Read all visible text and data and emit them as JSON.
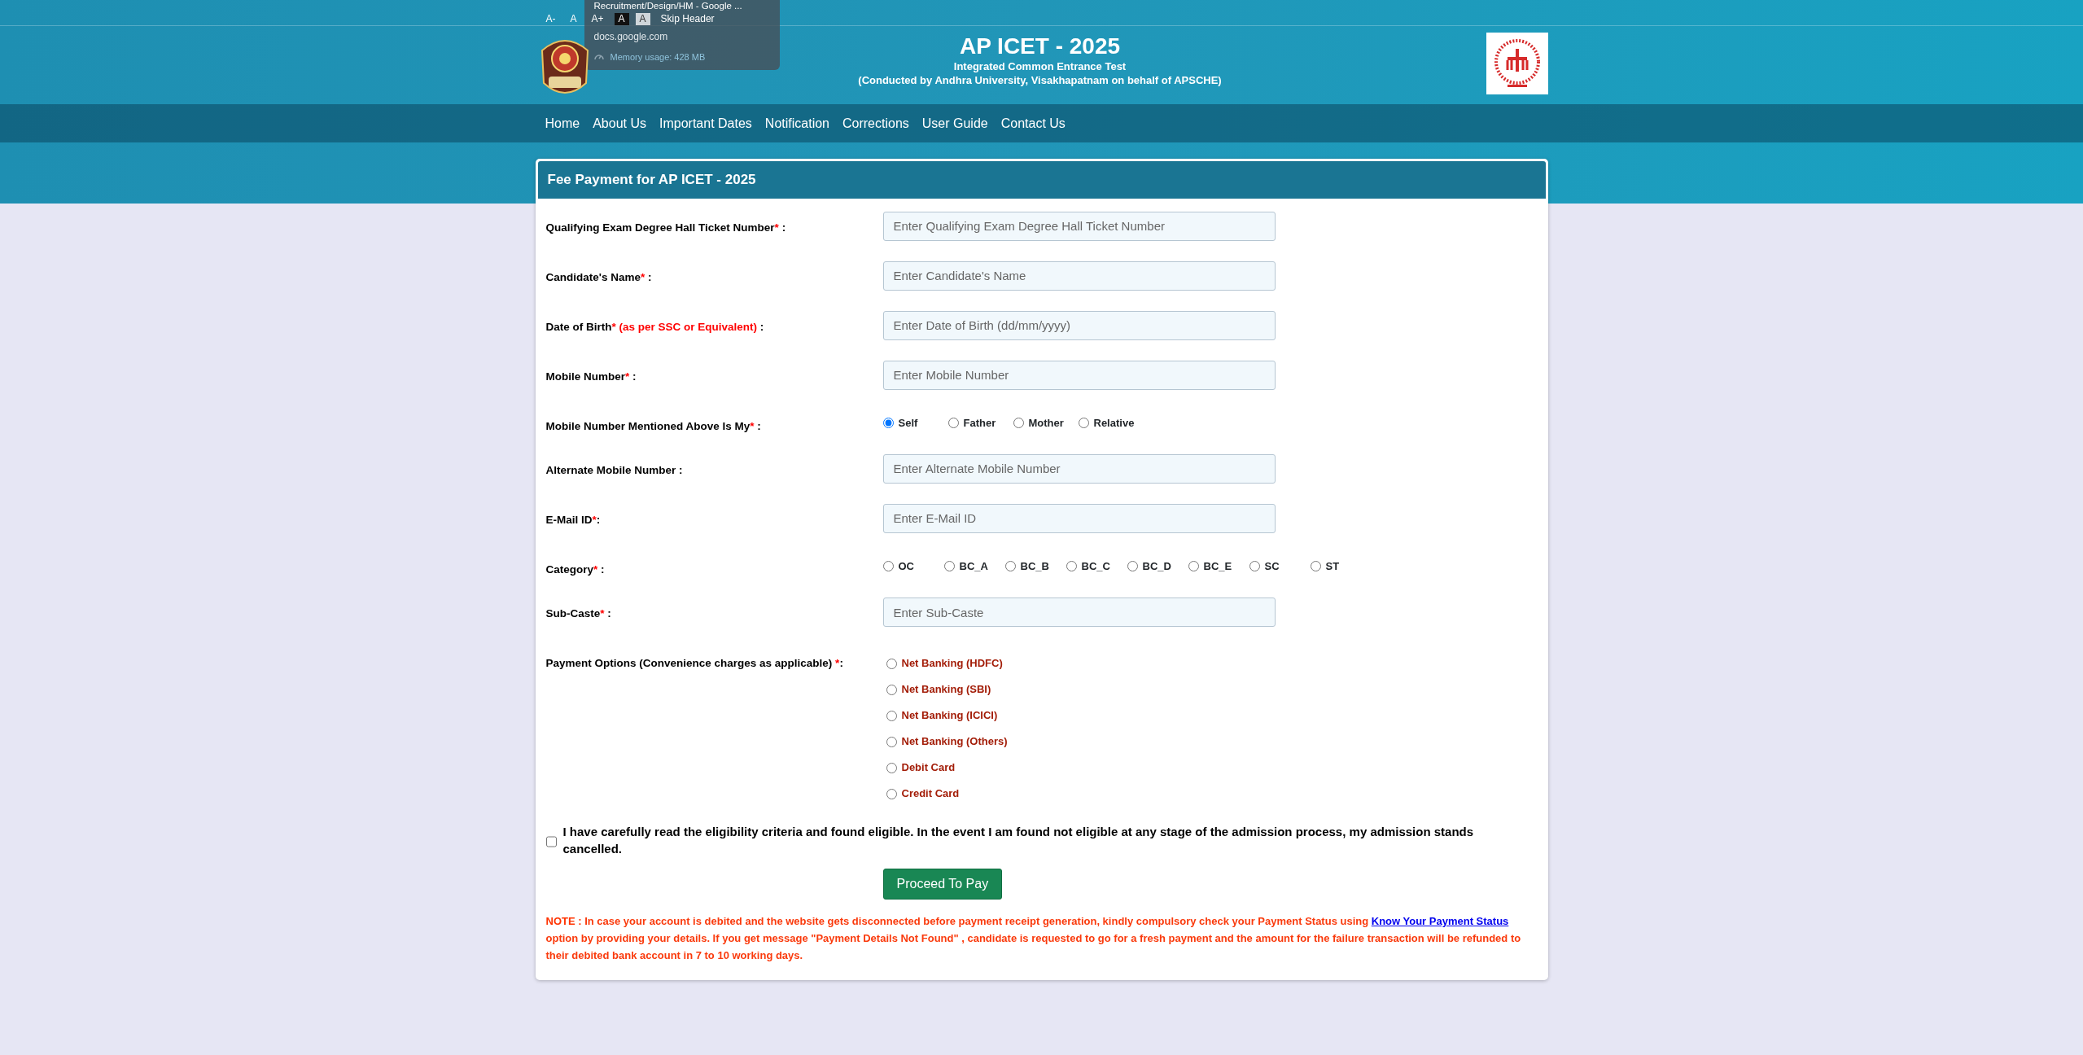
{
  "top_bar": {
    "items": [
      {
        "label": "A-",
        "kind": "plain"
      },
      {
        "label": "A",
        "kind": "plain"
      },
      {
        "label": "A+",
        "kind": "plain"
      },
      {
        "label": "A",
        "kind": "dark"
      },
      {
        "label": "A",
        "kind": "light"
      },
      {
        "label": "Skip Header",
        "kind": "plain"
      }
    ]
  },
  "hover_card": {
    "title": "Recruitment/Design/HM - Google ...",
    "url": "docs.google.com",
    "memory": "Memory usage: 428 MB"
  },
  "header": {
    "title": "AP ICET - 2025",
    "subtitle": "Integrated Common Entrance Test",
    "conducted_by": "(Conducted by Andhra University, Visakhapatnam on behalf of APSCHE)"
  },
  "nav": {
    "items": [
      "Home",
      "About Us",
      "Important Dates",
      "Notification",
      "Corrections",
      "User Guide",
      "Contact Us"
    ]
  },
  "form": {
    "title": "Fee Payment for AP ICET - 2025",
    "fields": [
      {
        "kind": "text",
        "label": "Qualifying Exam Degree Hall Ticket Number",
        "required_mark": "*",
        "suffix": " :",
        "placeholder": "Enter Qualifying Exam Degree Hall Ticket Number"
      },
      {
        "kind": "text",
        "label": "Candidate's Name",
        "required_mark": "*",
        "suffix": " :",
        "placeholder": "Enter Candidate's Name"
      },
      {
        "kind": "text",
        "label": "Date of Birth",
        "required_mark": "*",
        "note": " (as per SSC or Equivalent)",
        "suffix": " :",
        "placeholder": "Enter Date of Birth (dd/mm/yyyy)"
      },
      {
        "kind": "text",
        "label": "Mobile Number",
        "required_mark": "*",
        "suffix": " :",
        "placeholder": "Enter Mobile Number"
      },
      {
        "kind": "radio",
        "label": "Mobile Number Mentioned Above Is My",
        "required_mark": "*",
        "suffix": " :",
        "options": [
          {
            "label": "Self",
            "selected": true
          },
          {
            "label": "Father",
            "selected": false
          },
          {
            "label": "Mother",
            "selected": false
          },
          {
            "label": "Relative",
            "selected": false
          }
        ]
      },
      {
        "kind": "text",
        "label": "Alternate Mobile Number",
        "suffix": " :",
        "placeholder": "Enter Alternate Mobile Number"
      },
      {
        "kind": "text",
        "label": "E-Mail ID",
        "required_mark": "*",
        "suffix": ":",
        "placeholder": "Enter E-Mail ID"
      },
      {
        "kind": "radio",
        "label": "Category",
        "required_mark": "*",
        "suffix": " :",
        "options": [
          {
            "label": "OC",
            "selected": false
          },
          {
            "label": "BC_A",
            "selected": false
          },
          {
            "label": "BC_B",
            "selected": false
          },
          {
            "label": "BC_C",
            "selected": false
          },
          {
            "label": "BC_D",
            "selected": false
          },
          {
            "label": "BC_E",
            "selected": false
          },
          {
            "label": "SC",
            "selected": false
          },
          {
            "label": "ST",
            "selected": false
          }
        ]
      },
      {
        "kind": "text",
        "label": "Sub-Caste",
        "required_mark": "*",
        "suffix": " :",
        "placeholder": "Enter Sub-Caste"
      },
      {
        "kind": "radio-list",
        "label": "Payment Options (Convenience charges as applicable)",
        "required_mark": " *",
        "suffix": ":",
        "options": [
          {
            "label": "Net Banking (HDFC)",
            "selected": false
          },
          {
            "label": "Net Banking (SBI)",
            "selected": false
          },
          {
            "label": "Net Banking (ICICI)",
            "selected": false
          },
          {
            "label": "Net Banking (Others)",
            "selected": false
          },
          {
            "label": "Debit Card",
            "selected": false
          },
          {
            "label": "Credit Card",
            "selected": false
          }
        ]
      }
    ],
    "agreement": {
      "text": "I have carefully read the eligibility criteria and found eligible. In the event I am found not eligible at any stage of the admission process, my admission stands cancelled.",
      "checked": false
    },
    "submit": "Proceed To Pay",
    "note": {
      "label": "NOTE :",
      "text_before": " In case your account is debited and the website gets disconnected before payment receipt generation, kindly compulsory check your Payment Status using ",
      "link": "Know Your Payment Status",
      "text_after": " option by providing your details. If you get message \"Payment Details Not Found\" , candidate is requested to go for a fresh payment and the amount for the failure transaction will be refunded to their debited bank account in 7 to 10 working days."
    }
  }
}
